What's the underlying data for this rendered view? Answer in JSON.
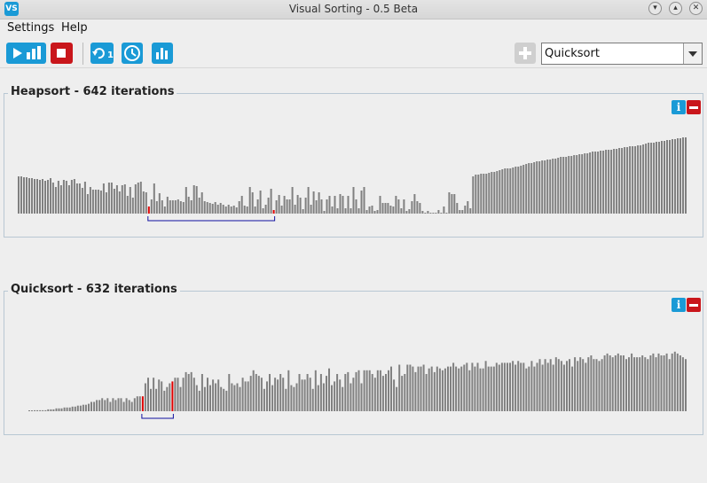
{
  "window": {
    "title": "Visual Sorting - 0.5 Beta",
    "app_icon_text": "VS"
  },
  "menu": [
    "Settings",
    "Help"
  ],
  "toolbar": {
    "buttons": [
      "play-visualize",
      "stop",
      "step-once",
      "timer",
      "statistics"
    ],
    "step_label": "1",
    "add_button_enabled": false,
    "algorithm_select": {
      "value": "Quicksort"
    }
  },
  "colors": {
    "accent": "#1a9ad6",
    "danger": "#c9161b",
    "bar": "#808080",
    "highlight": "#e00000",
    "range": "#1010a0"
  },
  "panels": [
    {
      "title": "Heapsort - 642 iterations",
      "values": [
        42,
        42,
        41,
        41,
        40,
        40,
        39,
        39,
        38,
        39,
        37,
        38,
        40,
        35,
        30,
        37,
        32,
        38,
        37,
        32,
        38,
        39,
        34,
        34,
        29,
        36,
        22,
        30,
        27,
        27,
        27,
        26,
        34,
        24,
        35,
        35,
        28,
        32,
        25,
        32,
        33,
        20,
        30,
        18,
        33,
        35,
        36,
        25,
        24,
        8,
        16,
        34,
        14,
        23,
        15,
        8,
        19,
        15,
        15,
        15,
        16,
        14,
        13,
        30,
        19,
        15,
        32,
        31,
        18,
        24,
        14,
        13,
        12,
        11,
        13,
        10,
        12,
        10,
        8,
        10,
        8,
        9,
        7,
        14,
        20,
        9,
        8,
        30,
        24,
        8,
        16,
        26,
        6,
        10,
        18,
        28,
        4,
        15,
        21,
        9,
        20,
        16,
        16,
        30,
        10,
        21,
        18,
        5,
        18,
        30,
        10,
        25,
        15,
        24,
        16,
        3,
        16,
        20,
        8,
        20,
        6,
        22,
        20,
        6,
        20,
        6,
        30,
        16,
        6,
        26,
        30,
        4,
        8,
        9,
        3,
        4,
        20,
        12,
        12,
        12,
        9,
        8,
        20,
        16,
        6,
        16,
        3,
        5,
        14,
        22,
        14,
        12,
        3,
        0,
        3,
        0,
        0,
        0,
        4,
        0,
        8,
        0,
        24,
        22,
        22,
        12,
        4,
        4,
        9,
        14,
        6,
        42,
        44,
        44,
        45,
        45,
        45,
        46,
        47,
        47,
        48,
        49,
        50,
        51,
        51,
        51,
        52,
        53,
        53,
        54,
        55,
        56,
        57,
        57,
        58,
        59,
        59,
        60,
        60,
        61,
        61,
        62,
        62,
        63,
        64,
        64,
        64,
        65,
        65,
        66,
        66,
        67,
        67,
        68,
        68,
        69,
        70,
        70,
        70,
        71,
        71,
        72,
        72,
        72,
        73,
        73,
        74,
        74,
        75,
        75,
        76,
        76,
        76,
        77,
        77,
        78,
        79,
        80,
        80,
        80,
        81,
        81,
        82,
        82,
        83,
        83,
        84,
        84,
        85,
        85,
        86,
        86
      ],
      "highlight": [
        49,
        96
      ],
      "range": [
        49,
        96
      ]
    },
    {
      "title": "Quicksort - 632 iterations",
      "values": [
        0,
        0,
        1,
        1,
        1,
        1,
        1,
        2,
        2,
        2,
        3,
        3,
        3,
        4,
        4,
        4,
        5,
        5,
        6,
        6,
        7,
        7,
        8,
        10,
        10,
        12,
        12,
        14,
        12,
        14,
        10,
        14,
        12,
        14,
        14,
        10,
        14,
        12,
        10,
        14,
        16,
        16,
        16,
        30,
        36,
        24,
        36,
        24,
        34,
        32,
        22,
        26,
        30,
        32,
        36,
        36,
        26,
        36,
        42,
        40,
        42,
        36,
        28,
        22,
        40,
        26,
        36,
        28,
        34,
        30,
        34,
        26,
        24,
        22,
        40,
        30,
        28,
        30,
        26,
        36,
        32,
        32,
        38,
        44,
        40,
        38,
        36,
        24,
        32,
        40,
        28,
        36,
        34,
        40,
        36,
        24,
        44,
        28,
        26,
        30,
        40,
        34,
        34,
        40,
        36,
        24,
        44,
        28,
        40,
        30,
        38,
        46,
        28,
        32,
        40,
        34,
        26,
        40,
        42,
        30,
        36,
        42,
        44,
        30,
        44,
        44,
        44,
        40,
        36,
        44,
        44,
        38,
        40,
        44,
        48,
        34,
        26,
        50,
        38,
        40,
        50,
        50,
        48,
        42,
        48,
        48,
        50,
        40,
        46,
        48,
        42,
        48,
        46,
        44,
        46,
        48,
        48,
        52,
        48,
        46,
        48,
        50,
        52,
        44,
        52,
        48,
        52,
        46,
        46,
        54,
        48,
        48,
        48,
        52,
        50,
        52,
        52,
        52,
        52,
        54,
        50,
        54,
        52,
        52,
        46,
        48,
        54,
        48,
        52,
        56,
        50,
        56,
        52,
        56,
        50,
        58,
        56,
        54,
        50,
        54,
        56,
        48,
        58,
        54,
        58,
        56,
        52,
        58,
        60,
        56,
        56,
        54,
        56,
        60,
        62,
        60,
        58,
        60,
        62,
        60,
        60,
        56,
        58,
        62,
        58,
        58,
        58,
        60,
        58,
        56,
        60,
        62,
        58,
        62,
        60,
        60,
        62,
        56,
        62,
        64,
        62,
        60,
        58,
        56
      ],
      "highlight": [
        42,
        53
      ],
      "range": [
        42,
        53
      ]
    }
  ]
}
